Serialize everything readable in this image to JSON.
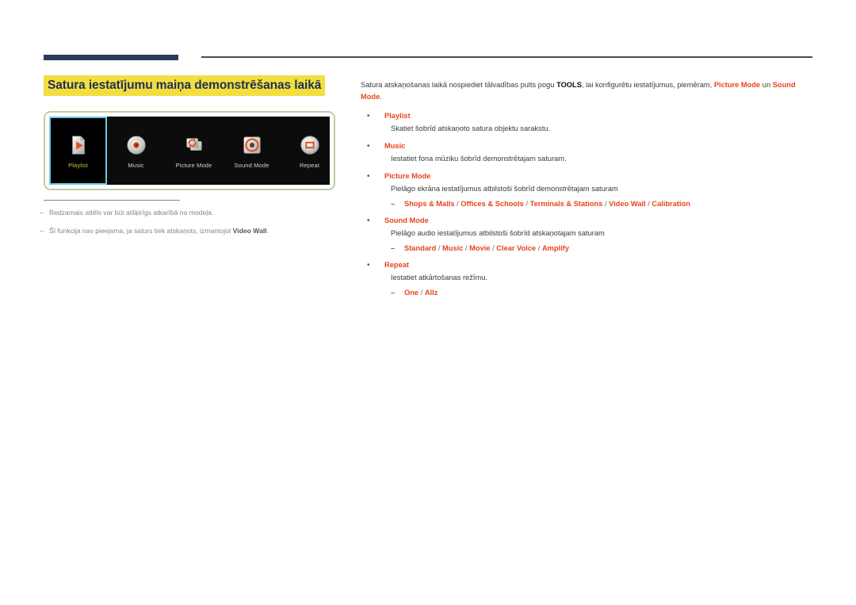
{
  "colors": {
    "accent_orange": "#e8441f",
    "title_highlight": "#f2de3f",
    "title_text": "#223055",
    "rule_navy": "#2b3a5c",
    "frame_green": "#b9cfa4",
    "selection_cyan": "#6ec8de",
    "selected_label_yellow": "#d9bb3f",
    "body_text": "#3b3b3b",
    "footnote_text": "#7d8694"
  },
  "section": {
    "title": "Satura iestatījumu maiņa demonstrēšanas laikā"
  },
  "device_menu": {
    "items": [
      {
        "label": "Playlist",
        "icon": "playlist-document-play-icon",
        "selected": true
      },
      {
        "label": "Music",
        "icon": "music-disc-icon",
        "selected": false
      },
      {
        "label": "Picture Mode",
        "icon": "picture-mode-refresh-cards-icon",
        "selected": false
      },
      {
        "label": "Sound Mode",
        "icon": "sound-mode-speaker-ring-icon",
        "selected": false
      },
      {
        "label": "Repeat",
        "icon": "repeat-loop-icon",
        "selected": false
      }
    ]
  },
  "footnotes": [
    {
      "dash": "–",
      "text_before": "Redzamais attēls var būt atšķirīgs atkarībā no modeļa.",
      "bold": "",
      "text_after": ""
    },
    {
      "dash": "–",
      "text_before": "Šī funkcija nav pieejama, ja saturs tiek atskaņots, izmantojot ",
      "bold": "Video Wall",
      "text_after": "."
    }
  ],
  "content": {
    "intro": {
      "part1": "Satura atskaņošanas laikā nospiediet tālvadības pults pogu ",
      "bold_tools": "TOOLS",
      "part2": ", lai konfigurētu iestatījumus, piemēram, ",
      "bold_picture_mode": "Picture Mode",
      "part3": " un ",
      "bold_sound_mode": "Sound Mode",
      "part4": "."
    },
    "bullets": [
      {
        "marker": "•",
        "term": "Playlist",
        "description": "Skatiet šobrīd atskaņoto satura objektu sarakstu.",
        "sub": null
      },
      {
        "marker": "•",
        "term": "Music",
        "description": "Iestatiet fona mūziku šobrīd demonstrētajam saturam.",
        "sub": null
      },
      {
        "marker": "•",
        "term": "Picture Mode",
        "description": "Pielāgo ekrāna iestatījumus atbilstoši šobrīd demonstrētajam saturam",
        "sub": {
          "dash": "–",
          "options": [
            "Shops & Malls",
            "Offices & Schools",
            "Terminals & Stations",
            "Video Wall",
            "Calibration"
          ]
        }
      },
      {
        "marker": "•",
        "term": "Sound Mode",
        "description": "Pielāgo audio iestatījumus atbilstoši šobrīd atskaņotajam saturam",
        "sub": {
          "dash": "–",
          "options": [
            "Standard",
            "Music",
            "Movie",
            "Clear Voice",
            "Amplify"
          ]
        }
      },
      {
        "marker": "•",
        "term": "Repeat",
        "description": "Iestatiet atkārtošanas režīmu.",
        "sub": {
          "dash": "–",
          "options": [
            "One",
            "Allz"
          ]
        }
      }
    ]
  }
}
